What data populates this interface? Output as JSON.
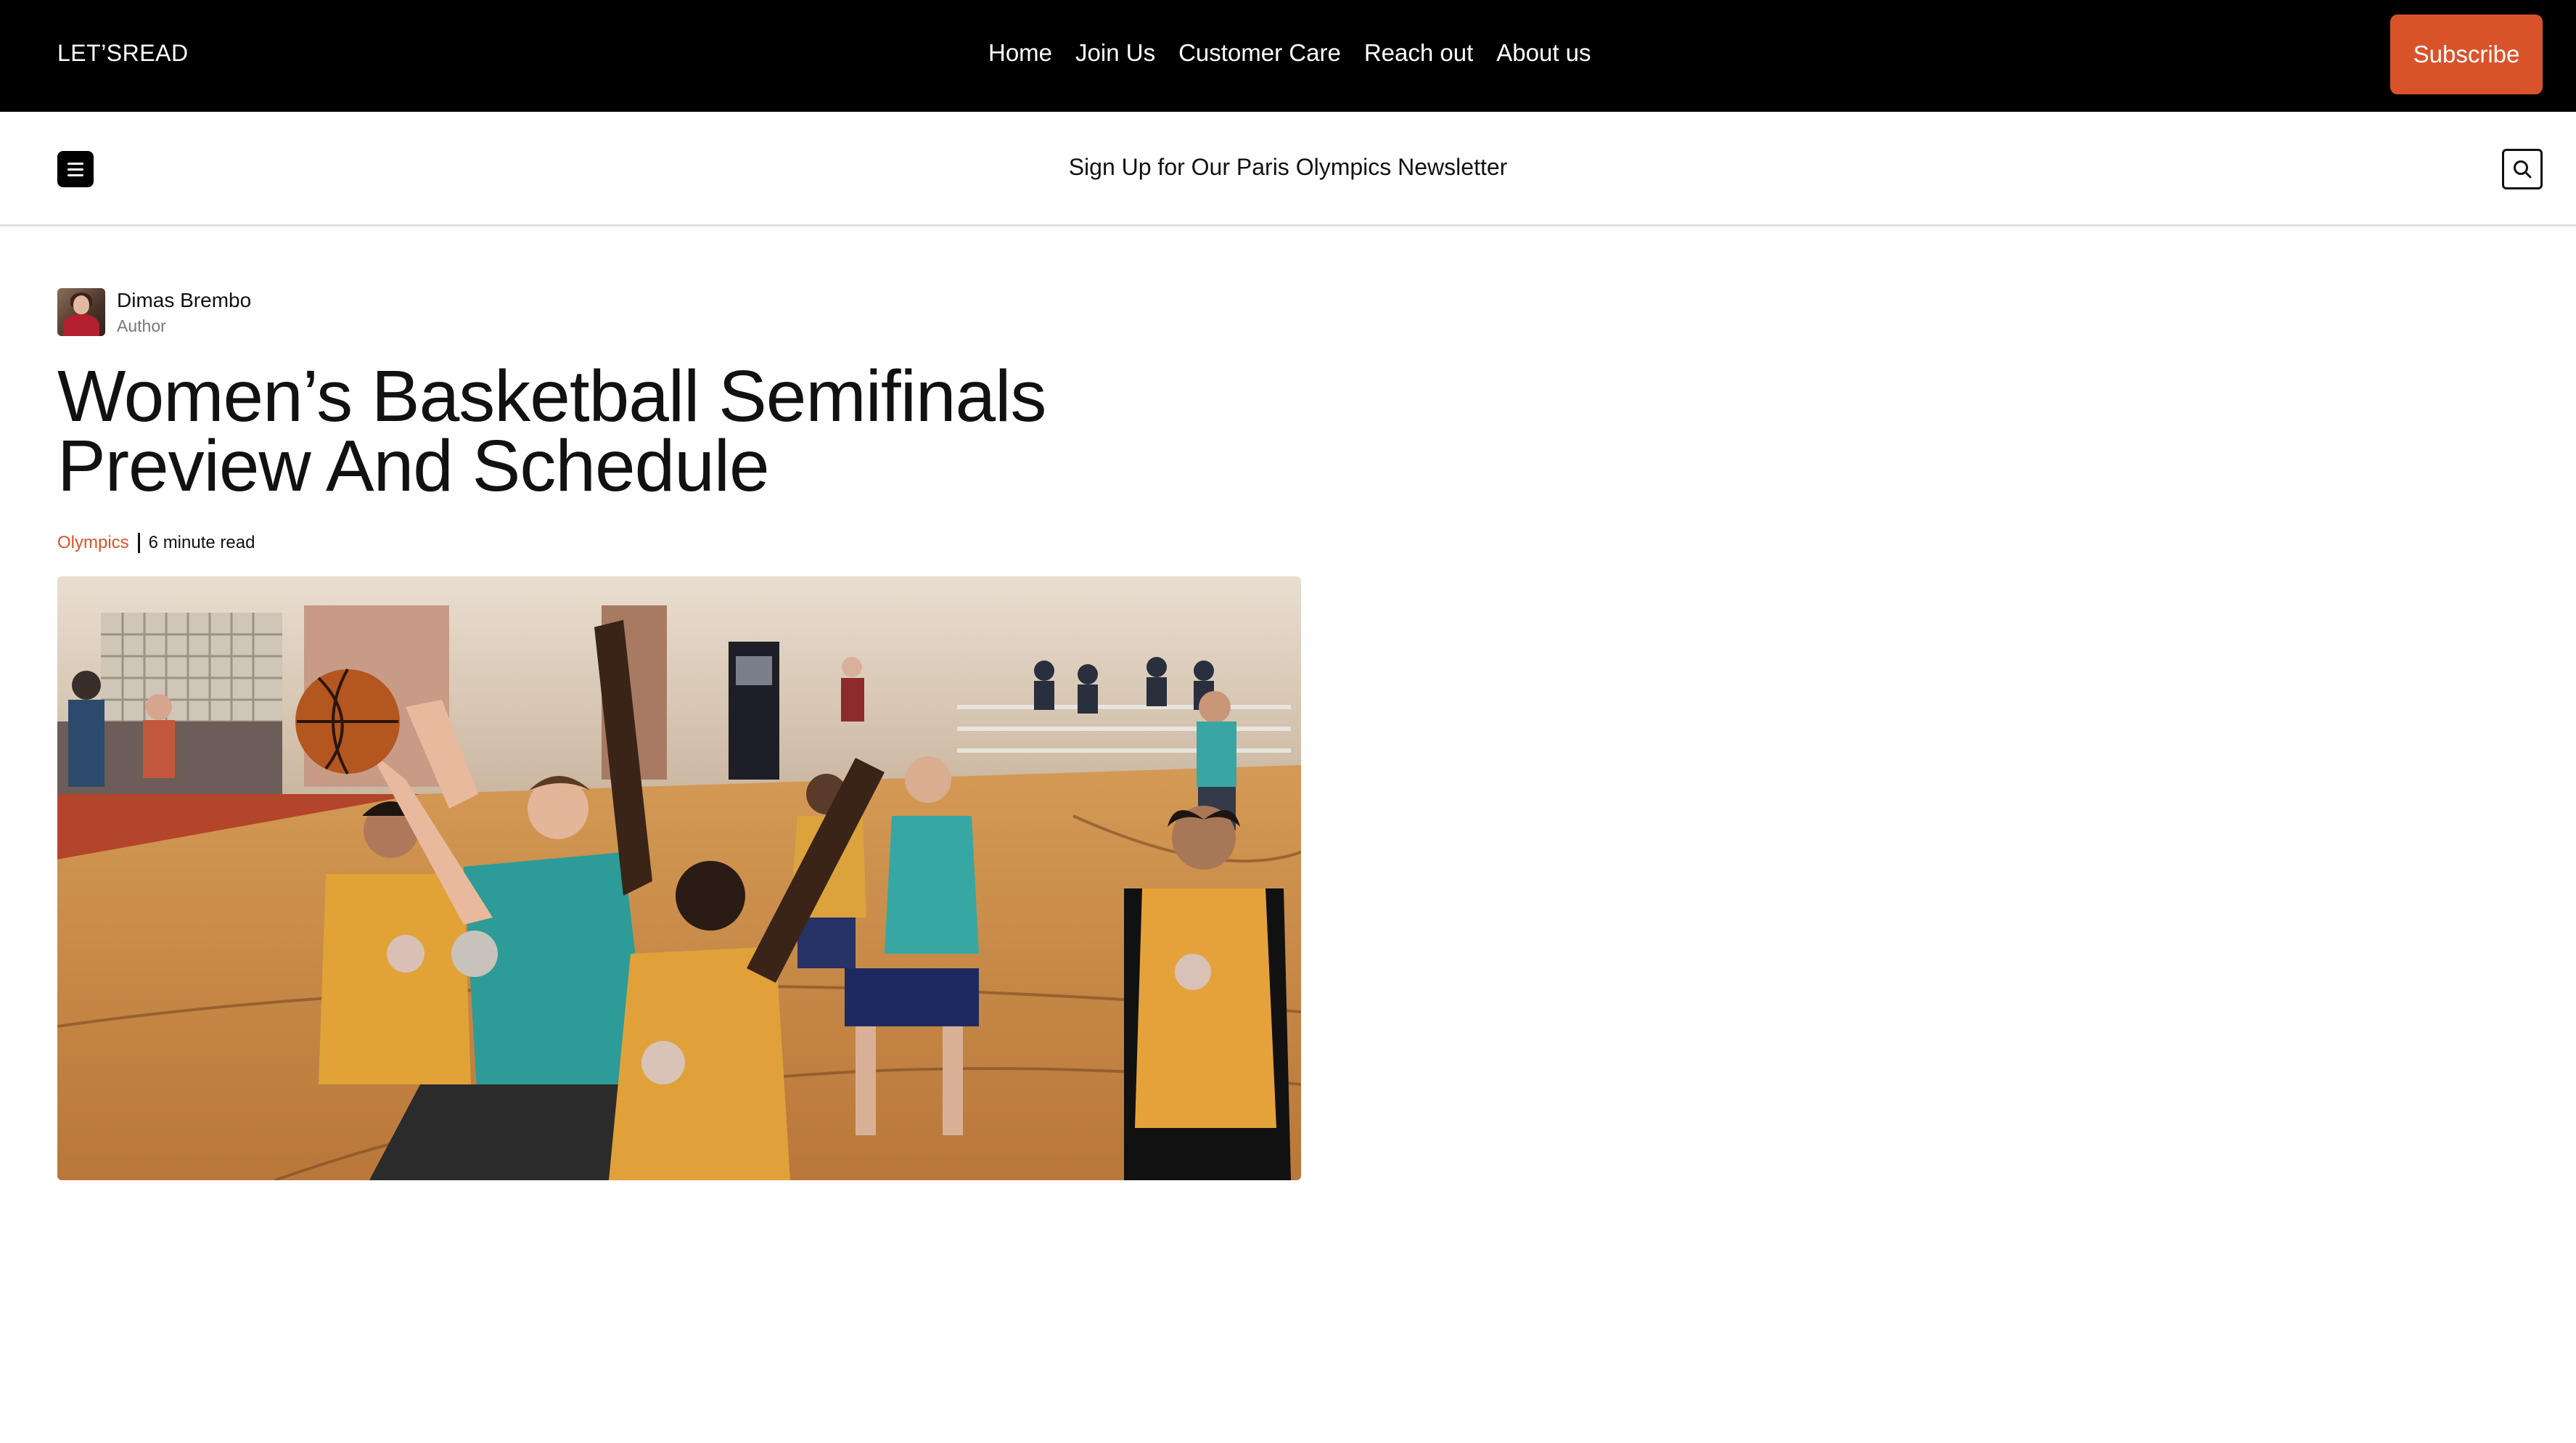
{
  "header": {
    "logo": "LET’SREAD",
    "nav": [
      "Home",
      "Join Us",
      "Customer Care",
      "Reach out",
      "About us"
    ],
    "subscribe_label": "Subscribe"
  },
  "subheader": {
    "menu_icon": "hamburger-menu-icon",
    "promo_text": "Sign Up for Our Paris Olympics Newsletter",
    "search_icon": "search-icon"
  },
  "article": {
    "author_name": "Dimas Brembo",
    "author_role": "Author",
    "title": "Women’s Basketball Semifinals Preview And Schedule",
    "category": "Olympics",
    "read_time": "6 minute read"
  },
  "colors": {
    "accent": "#d9532a",
    "topbar_bg": "#000000"
  }
}
